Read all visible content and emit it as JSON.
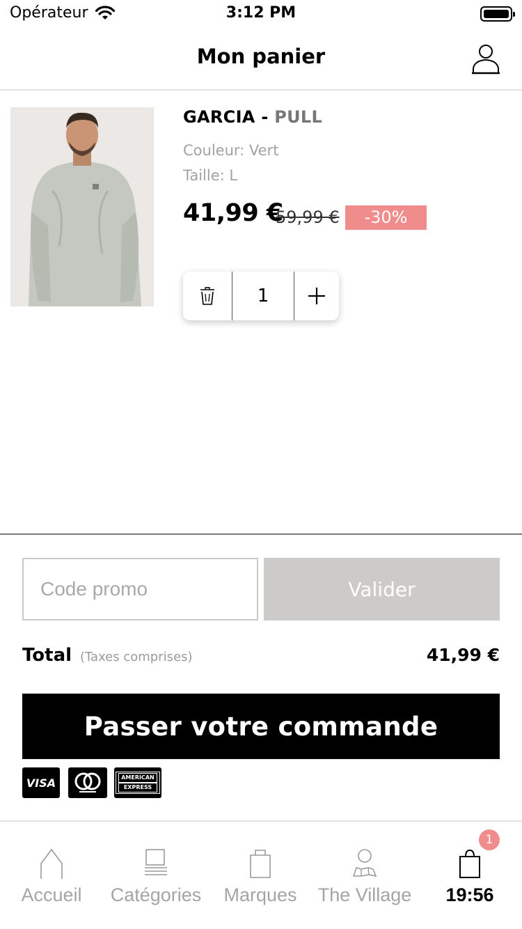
{
  "status_bar": {
    "carrier": "Opérateur",
    "time": "3:12 PM"
  },
  "header": {
    "title": "Mon panier"
  },
  "cart_item": {
    "brand": "GARCIA",
    "separator": " - ",
    "product_type": "PULL",
    "color_label": "Couleur: Vert",
    "size_label": "Taille: L",
    "price": "41,99 €",
    "old_price": "59,99 €",
    "discount": "-30%",
    "quantity": "1"
  },
  "promo": {
    "placeholder": "Code promo",
    "validate_label": "Valider"
  },
  "total": {
    "label": "Total",
    "note": "(Taxes comprises)",
    "value": "41,99 €"
  },
  "order_button": {
    "label": "Passer votre commande"
  },
  "payment_methods": {
    "visa": "VISA",
    "amex_line1": "AMERICAN",
    "amex_line2": "EXPRESS"
  },
  "tabbar": {
    "items": [
      {
        "label": "Accueil",
        "icon": "home-icon"
      },
      {
        "label": "Catégories",
        "icon": "categories-icon"
      },
      {
        "label": "Marques",
        "icon": "shopping-bag-icon"
      },
      {
        "label": "The Village",
        "icon": "village-map-icon"
      },
      {
        "label": "19:56",
        "icon": "cart-bag-icon"
      }
    ],
    "cart_badge": "1"
  },
  "colors": {
    "accent_discount": "#f08c8c",
    "primary_button": "#000000",
    "disabled_button": "#cdcbca"
  }
}
